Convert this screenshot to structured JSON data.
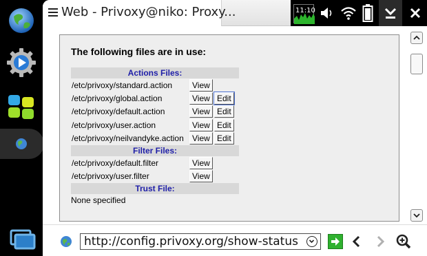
{
  "window": {
    "title": "Web - Privoxy@niko: Proxy..."
  },
  "status": {
    "clock": "11:10"
  },
  "page": {
    "heading": "The following files are in use:",
    "sections": [
      {
        "header": "Actions Files:",
        "rows": [
          {
            "path": "/etc/privoxy/standard.action",
            "view": "View",
            "edit": ""
          },
          {
            "path": "/etc/privoxy/global.action",
            "view": "View",
            "edit": "Edit"
          },
          {
            "path": "/etc/privoxy/default.action",
            "view": "View",
            "edit": "Edit"
          },
          {
            "path": "/etc/privoxy/user.action",
            "view": "View",
            "edit": "Edit"
          },
          {
            "path": "/etc/privoxy/neilvandyke.action",
            "view": "View",
            "edit": "Edit"
          }
        ]
      },
      {
        "header": "Filter Files:",
        "rows": [
          {
            "path": "/etc/privoxy/default.filter",
            "view": "View",
            "edit": ""
          },
          {
            "path": "/etc/privoxy/user.filter",
            "view": "View",
            "edit": ""
          }
        ]
      },
      {
        "header": "Trust File:",
        "note": "None specified"
      }
    ]
  },
  "urlbar": {
    "url": "http://config.privoxy.org/show-status"
  },
  "colors": {
    "header_text": "#1e1ea8",
    "header_bg": "#d8d8d8",
    "panel_bg": "#eeeeee",
    "go_green": "#2fb12f"
  },
  "icons": {
    "dock": [
      "globe-icon",
      "settings-icon",
      "apps-icon",
      "browser-tab-icon",
      "task-switcher-icon"
    ],
    "status": [
      "cpu-monitor-icon",
      "volume-icon",
      "wifi-icon",
      "battery-icon",
      "minimize-icon",
      "close-icon"
    ],
    "bottom": [
      "site-globe-icon",
      "url-dropdown-icon",
      "go-icon",
      "back-icon",
      "forward-icon",
      "zoom-icon"
    ]
  }
}
